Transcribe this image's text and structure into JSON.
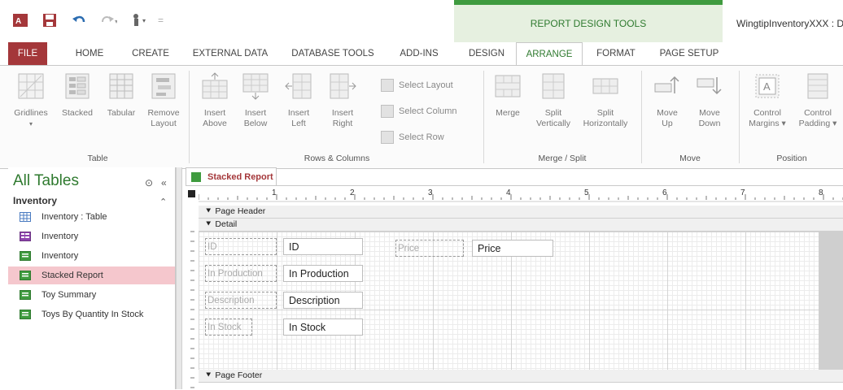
{
  "titlebar": {
    "context_label": "REPORT DESIGN TOOLS",
    "window_title": "WingtipInventoryXXX : D"
  },
  "tabs": [
    "FILE",
    "HOME",
    "CREATE",
    "EXTERNAL DATA",
    "DATABASE TOOLS",
    "ADD-INS",
    "DESIGN",
    "ARRANGE",
    "FORMAT",
    "PAGE SETUP"
  ],
  "active_tab": "ARRANGE",
  "ribbon": {
    "table": {
      "label": "Table",
      "gridlines": "Gridlines",
      "stacked": "Stacked",
      "tabular": "Tabular",
      "remove_layout_1": "Remove",
      "remove_layout_2": "Layout"
    },
    "rows_cols": {
      "label": "Rows & Columns",
      "insert_above_1": "Insert",
      "insert_above_2": "Above",
      "insert_below_1": "Insert",
      "insert_below_2": "Below",
      "insert_left_1": "Insert",
      "insert_left_2": "Left",
      "insert_right_1": "Insert",
      "insert_right_2": "Right",
      "select_layout": "Select Layout",
      "select_column": "Select Column",
      "select_row": "Select Row"
    },
    "merge_split": {
      "label": "Merge / Split",
      "merge": "Merge",
      "split_v_1": "Split",
      "split_v_2": "Vertically",
      "split_h_1": "Split",
      "split_h_2": "Horizontally"
    },
    "move": {
      "label": "Move",
      "up_1": "Move",
      "up_2": "Up",
      "down_1": "Move",
      "down_2": "Down"
    },
    "position": {
      "label": "Position",
      "margins_1": "Control",
      "margins_2": "Margins",
      "padding_1": "Control",
      "padding_2": "Padding"
    }
  },
  "nav": {
    "title": "All Tables",
    "group": "Inventory",
    "items": [
      {
        "label": "Inventory : Table",
        "icon": "table-icon"
      },
      {
        "label": "Inventory",
        "icon": "form-icon"
      },
      {
        "label": "Inventory",
        "icon": "report-icon"
      },
      {
        "label": "Stacked Report",
        "icon": "report-icon"
      },
      {
        "label": "Toy Summary",
        "icon": "report-icon"
      },
      {
        "label": "Toys By Quantity In Stock",
        "icon": "report-icon"
      }
    ],
    "selected": "Stacked Report"
  },
  "document": {
    "tab_label": "Stacked Report",
    "ruler_numbers": [
      "1",
      "2",
      "3",
      "4",
      "5",
      "6",
      "7",
      "8"
    ],
    "sections": {
      "page_header": "Page Header",
      "detail": "Detail",
      "page_footer": "Page Footer"
    },
    "labels": [
      "ID",
      "In Production",
      "Description",
      "In Stock",
      "Price"
    ],
    "controls": [
      "ID",
      "In Production",
      "Description",
      "In Stock",
      "Price"
    ]
  },
  "colors": {
    "access_red": "#a4373a",
    "tools_green": "#3f9b3f",
    "selected_item": "#f5c7cd"
  }
}
